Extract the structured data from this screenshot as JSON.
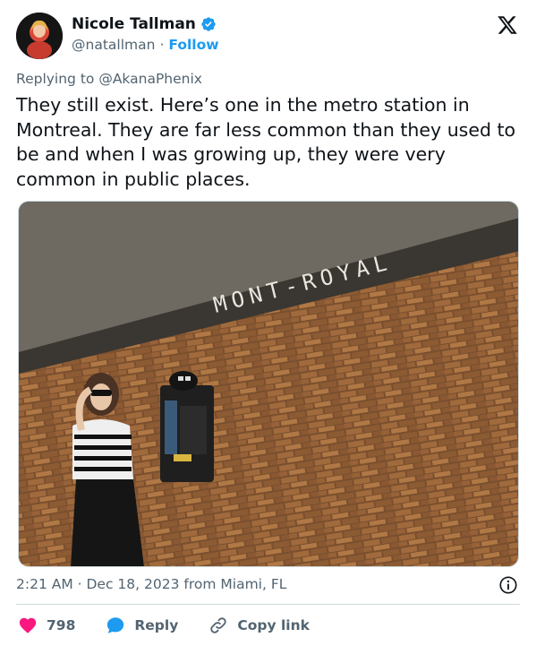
{
  "author": {
    "name": "Nicole Tallman",
    "handle": "@natallman",
    "separator": "·",
    "follow_label": "Follow"
  },
  "reply_context": {
    "prefix": "Replying to ",
    "mention": "@AkanaPhenix"
  },
  "tweet": {
    "text": "They still exist. Here’s one in the metro station in Montreal. They are far less common than they used to be and when I was growing up, they were very common in public places."
  },
  "photo": {
    "sign_text": "MONT-ROYAL"
  },
  "meta": {
    "time": "2:21 AM",
    "separator": " · ",
    "date": "Dec 18, 2023",
    "location_prefix": " from ",
    "location": "Miami, FL"
  },
  "actions": {
    "likes": "798",
    "reply_label": "Reply",
    "copy_link_label": "Copy link"
  },
  "colors": {
    "accent": "#1d9bf0",
    "like": "#f91880",
    "muted": "#536471"
  },
  "icons": [
    "verified-badge-icon",
    "x-logo-icon",
    "info-icon",
    "heart-icon",
    "reply-bubble-icon",
    "link-icon"
  ]
}
